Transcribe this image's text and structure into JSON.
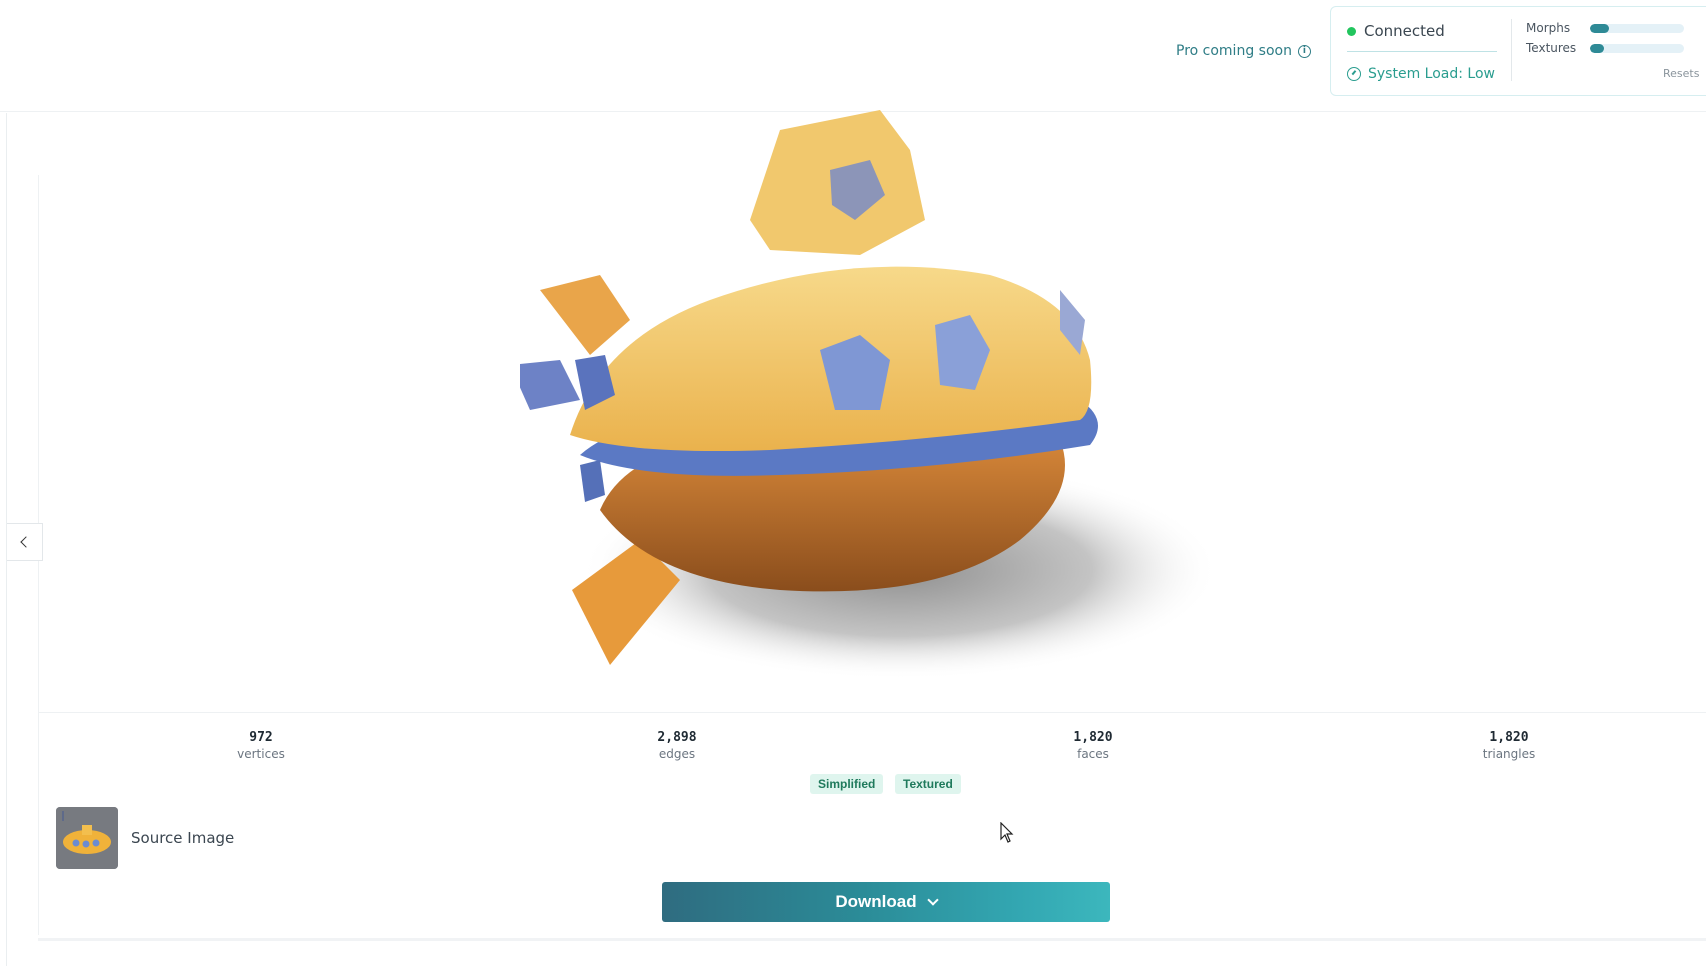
{
  "header": {
    "pro_label": "Pro coming soon",
    "status": {
      "connection": "Connected",
      "system_load": "System Load: Low",
      "meters": [
        {
          "label": "Morphs",
          "fill": 0.2
        },
        {
          "label": "Textures",
          "fill": 0.15
        }
      ],
      "resets_label": "Resets"
    }
  },
  "viewer": {
    "model": "yellow submarine 3D model"
  },
  "stats": [
    {
      "value": "972",
      "label": "vertices"
    },
    {
      "value": "2,898",
      "label": "edges"
    },
    {
      "value": "1,820",
      "label": "faces"
    },
    {
      "value": "1,820",
      "label": "triangles"
    }
  ],
  "tags": [
    "Simplified",
    "Textured"
  ],
  "source": {
    "label": "Source Image"
  },
  "download": {
    "label": "Download"
  },
  "colors": {
    "accent": "#2e8a96",
    "connected": "#22c55e",
    "tag_bg": "#dff5ee"
  }
}
